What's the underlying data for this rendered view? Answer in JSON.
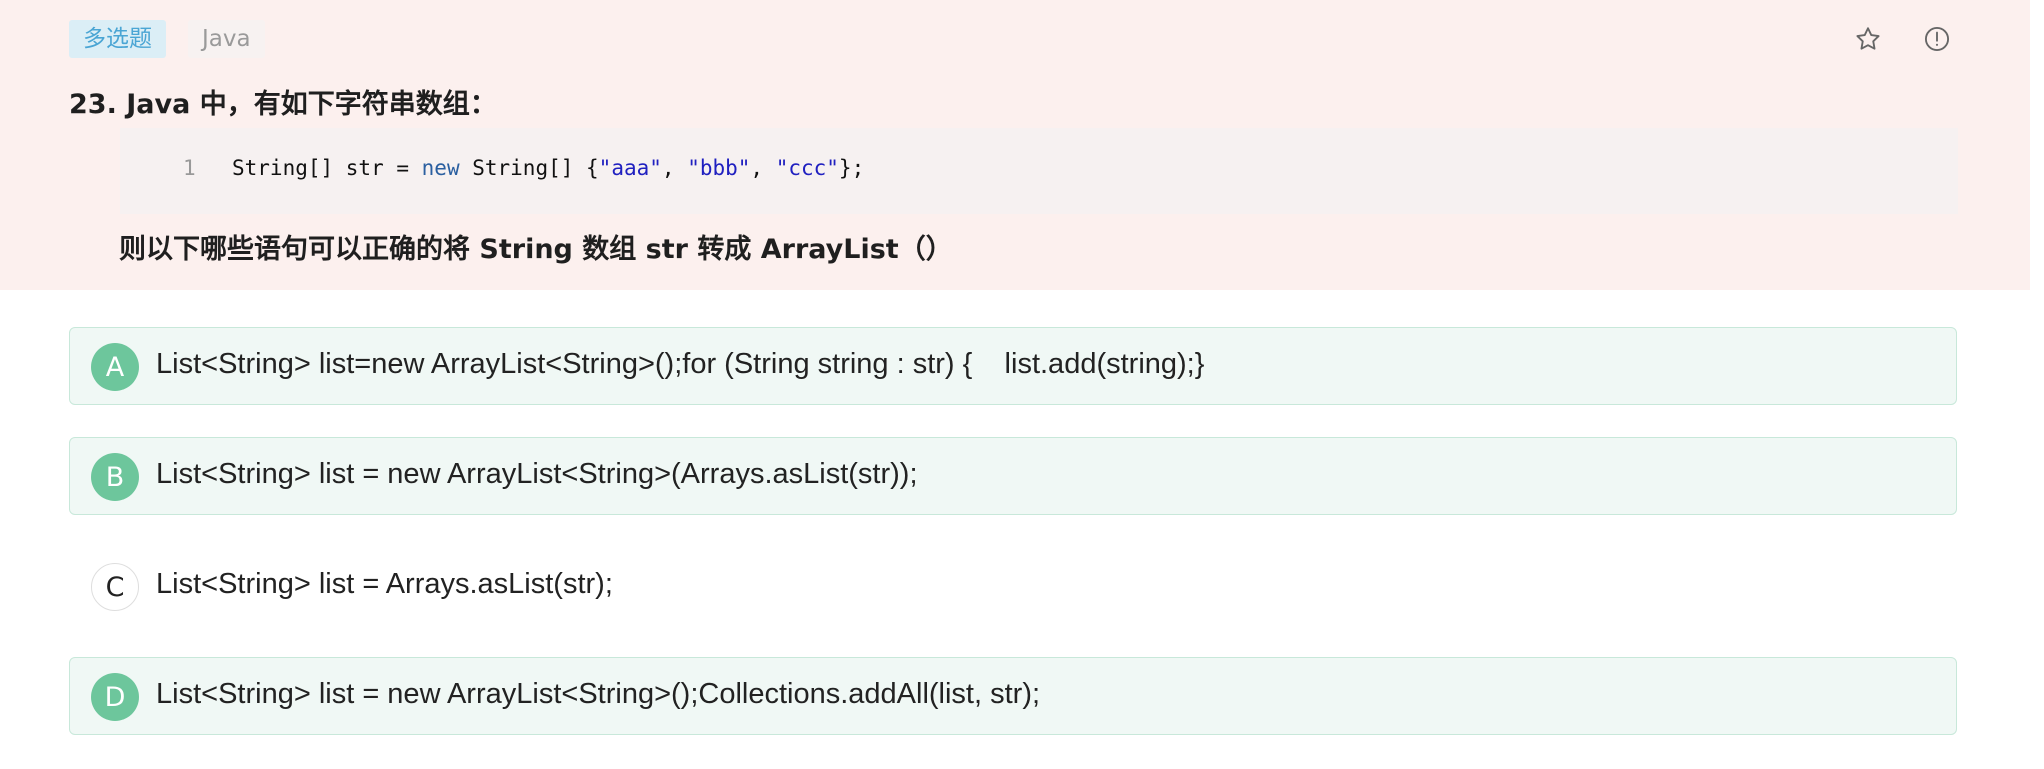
{
  "question": {
    "type_tag": "多选题",
    "language_tag": "Java",
    "title": "23. Java 中，有如下字符串数组：",
    "code": {
      "line_number": "1",
      "segments": [
        {
          "text": "String[] str = ",
          "kind": "plain"
        },
        {
          "text": "new",
          "kind": "keyword"
        },
        {
          "text": " String[] {",
          "kind": "plain"
        },
        {
          "text": "\"aaa\"",
          "kind": "string"
        },
        {
          "text": ", ",
          "kind": "plain"
        },
        {
          "text": "\"bbb\"",
          "kind": "string"
        },
        {
          "text": ", ",
          "kind": "plain"
        },
        {
          "text": "\"ccc\"",
          "kind": "string"
        },
        {
          "text": "};",
          "kind": "plain"
        }
      ]
    },
    "subtitle": "则以下哪些语句可以正确的将 String 数组 str 转成 ArrayList（）"
  },
  "actions": {
    "favorite_icon": "star-icon",
    "report_icon": "info-circle-icon"
  },
  "options": [
    {
      "letter": "A",
      "text": "List<String> list=new ArrayList<String>();for (String string : str) {    list.add(string);}",
      "selected": true
    },
    {
      "letter": "B",
      "text": "List<String> list = new ArrayList<String>(Arrays.asList(str));",
      "selected": true
    },
    {
      "letter": "C",
      "text": "List<String> list = Arrays.asList(str);",
      "selected": false
    },
    {
      "letter": "D",
      "text": "List<String> list = new ArrayList<String>();Collections.addAll(list, str);",
      "selected": true
    }
  ],
  "colors": {
    "question_bg": "#fcf0ee",
    "selected_bg": "#f0f8f5",
    "selected_accent": "#6dc69c",
    "tag_type_text": "#4aa5d4"
  }
}
